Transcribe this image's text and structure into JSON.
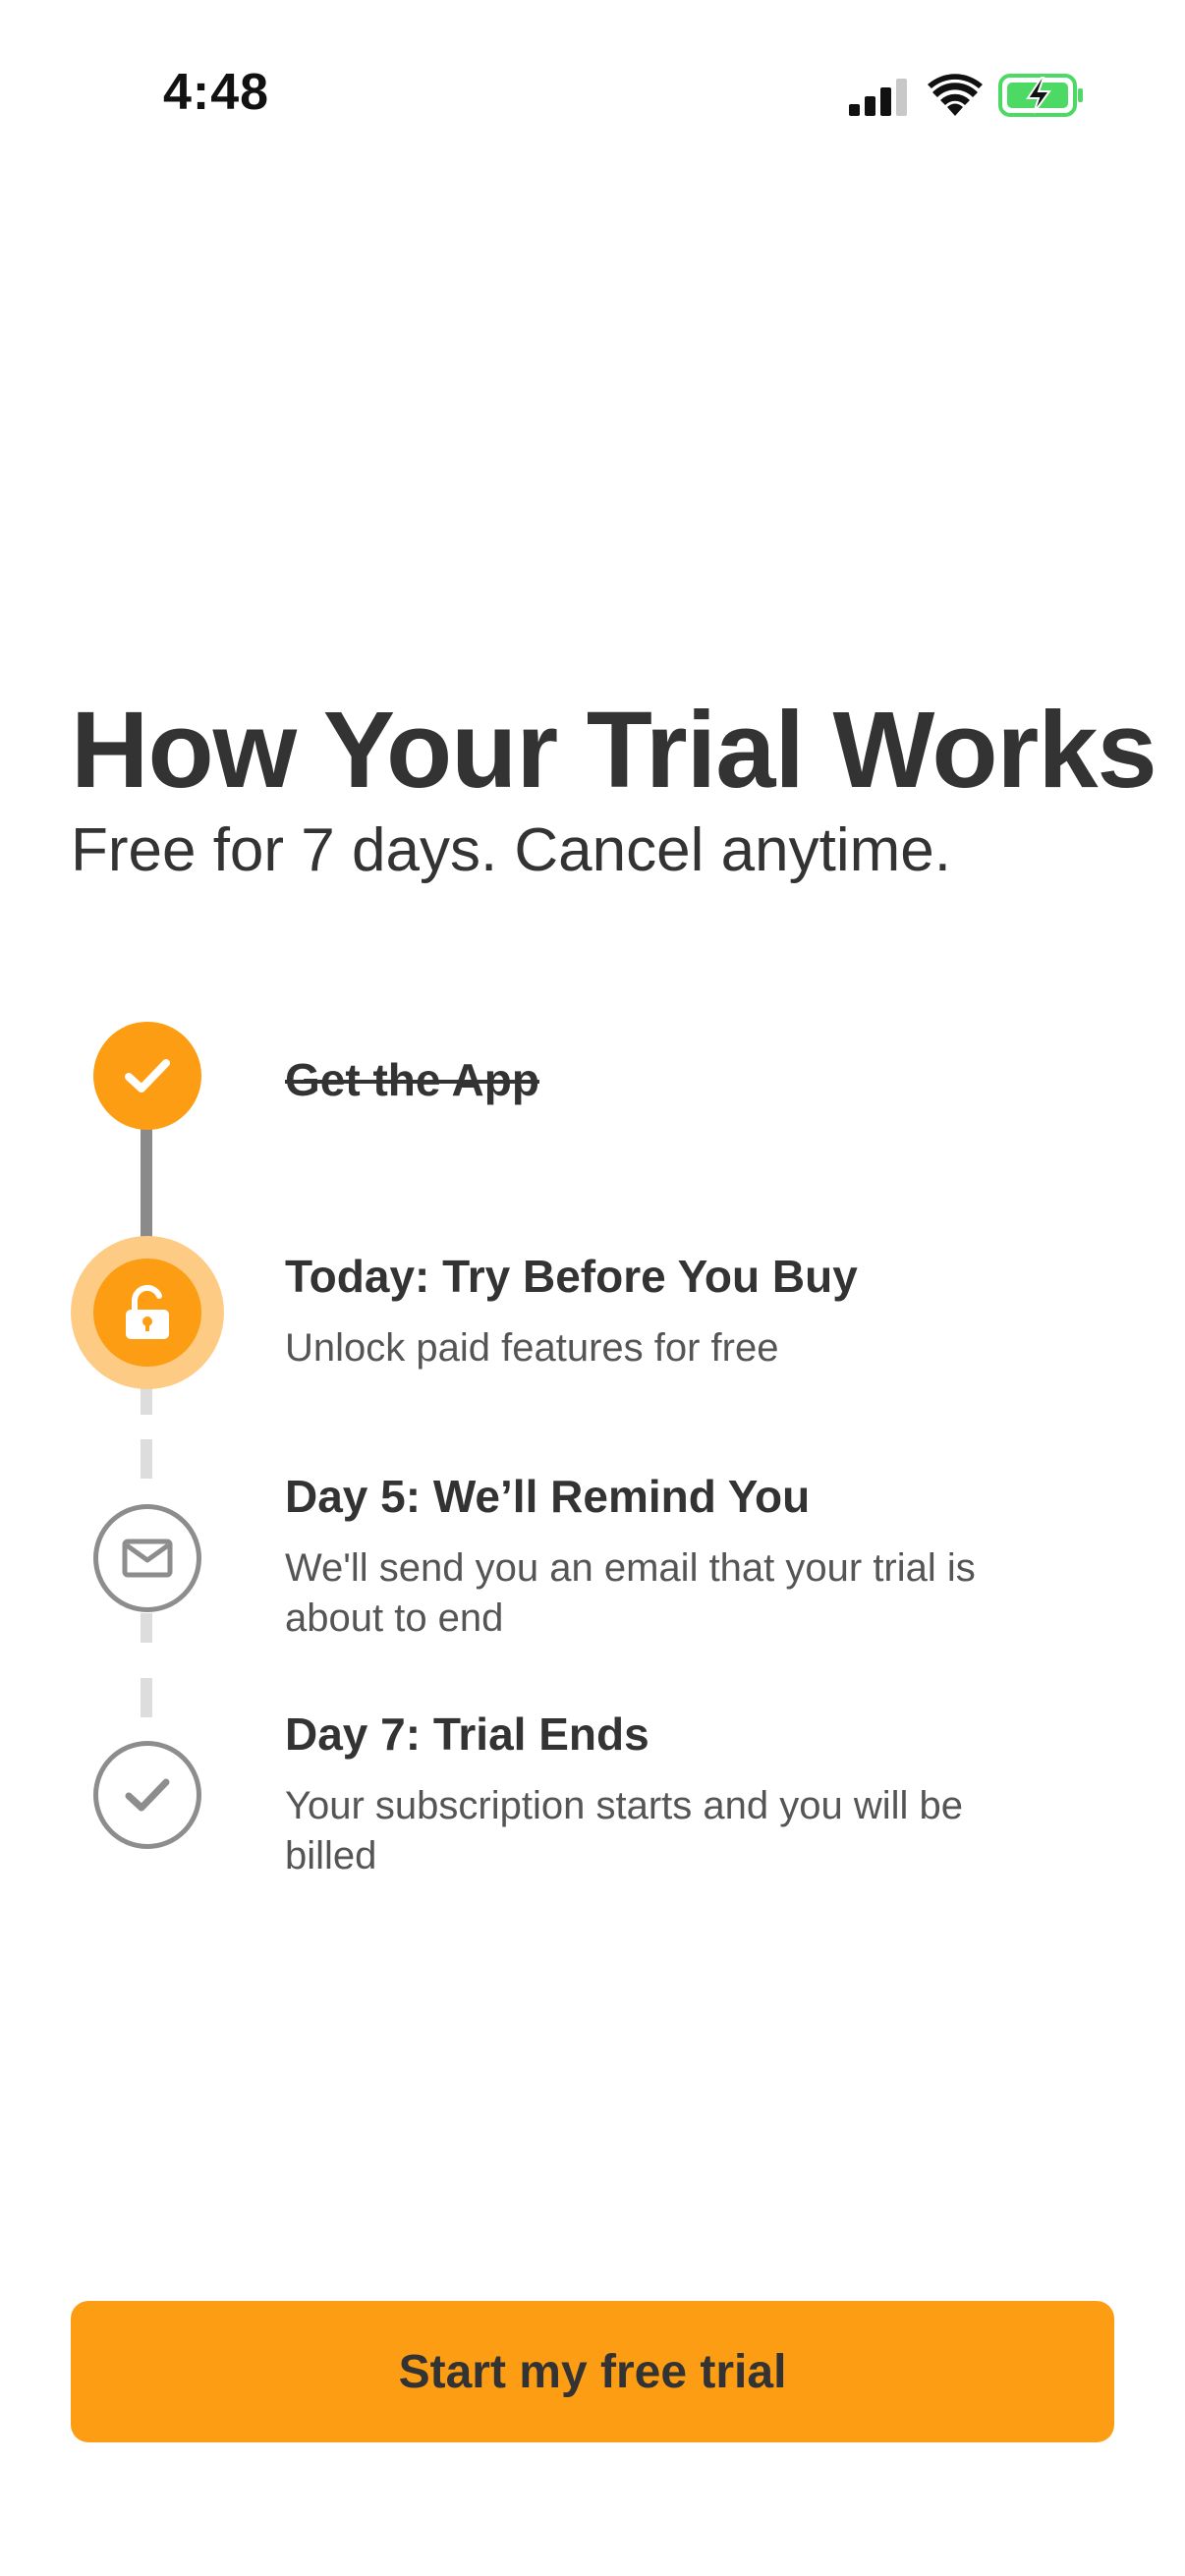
{
  "status_bar": {
    "time": "4:48",
    "icons": [
      "cellular-signal-icon",
      "wifi-icon",
      "battery-charging-icon"
    ],
    "battery_color": "#4cd964"
  },
  "header": {
    "title": "How Your Trial Works",
    "subtitle": "Free for 7 days. Cancel anytime."
  },
  "timeline": {
    "steps": [
      {
        "title": "Get the App",
        "description": "",
        "icon": "checkmark-icon",
        "state": "completed"
      },
      {
        "title": "Today: Try Before You Buy",
        "description": "Unlock paid features for free",
        "icon": "unlock-icon",
        "state": "current"
      },
      {
        "title": "Day 5: We’ll Remind You",
        "description": "We'll send you an email that your trial is about to end",
        "icon": "envelope-icon",
        "state": "upcoming"
      },
      {
        "title": "Day 7: Trial Ends",
        "description": "Your subscription starts and you will be billed",
        "icon": "checkmark-icon",
        "state": "upcoming"
      }
    ]
  },
  "cta": {
    "label": "Start my free trial"
  },
  "colors": {
    "accent": "#fc9d13",
    "accent_light": "#fdcb84",
    "text": "#333333",
    "muted": "#8d8d8d"
  }
}
